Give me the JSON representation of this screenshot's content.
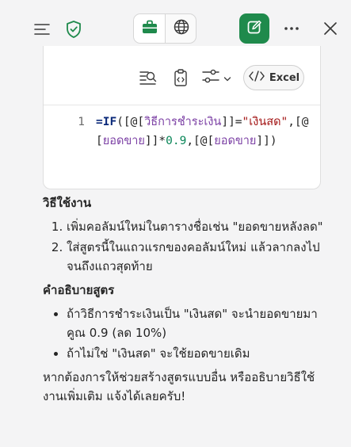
{
  "header": {
    "menu_icon": "hamburger-icon",
    "shield_icon": "shield-check-icon",
    "work_icon": "briefcase-icon",
    "web_icon": "globe-icon",
    "new_chat_icon": "compose-icon",
    "more_icon": "ellipsis-icon",
    "close_icon": "close-icon",
    "accent": "#1f8a4c"
  },
  "code_card": {
    "excel_label": "Excel",
    "line_number": "1",
    "formula_parts": {
      "p1": "=IF",
      "p2": "([@[",
      "p3": "วิธีการชำระเงิน",
      "p4": "]]=",
      "p5": "\"เงินสด\"",
      "p6": ",[@[",
      "p7": "ยอดขาย",
      "p8": "]]*",
      "p9": "0.9",
      "p10": ",[@[",
      "p11": "ยอดขาย",
      "p12": "]])"
    }
  },
  "answer": {
    "usage_heading": "วิธีใช้งาน",
    "usage_steps": [
      "เพิ่มคอลัมน์ใหม่ในตารางชื่อเช่น \"ยอดขายหลังลด\"",
      "ใส่สูตรนี้ในแถวแรกของคอลัมน์ใหม่ แล้วลากลงไปจนถึงแถวสุดท้าย"
    ],
    "explain_heading": "คำอธิบายสูตร",
    "explain_points": [
      "ถ้าวิธีการชำระเงินเป็น \"เงินสด\" จะนำยอดขายมาคูณ 0.9 (ลด 10%)",
      "ถ้าไม่ใช่ \"เงินสด\" จะใช้ยอดขายเดิม"
    ],
    "closing": "หากต้องการให้ช่วยสร้างสูตรแบบอื่น หรืออธิบายวิธีใช้งานเพิ่มเติม แจ้งได้เลยครับ!"
  }
}
